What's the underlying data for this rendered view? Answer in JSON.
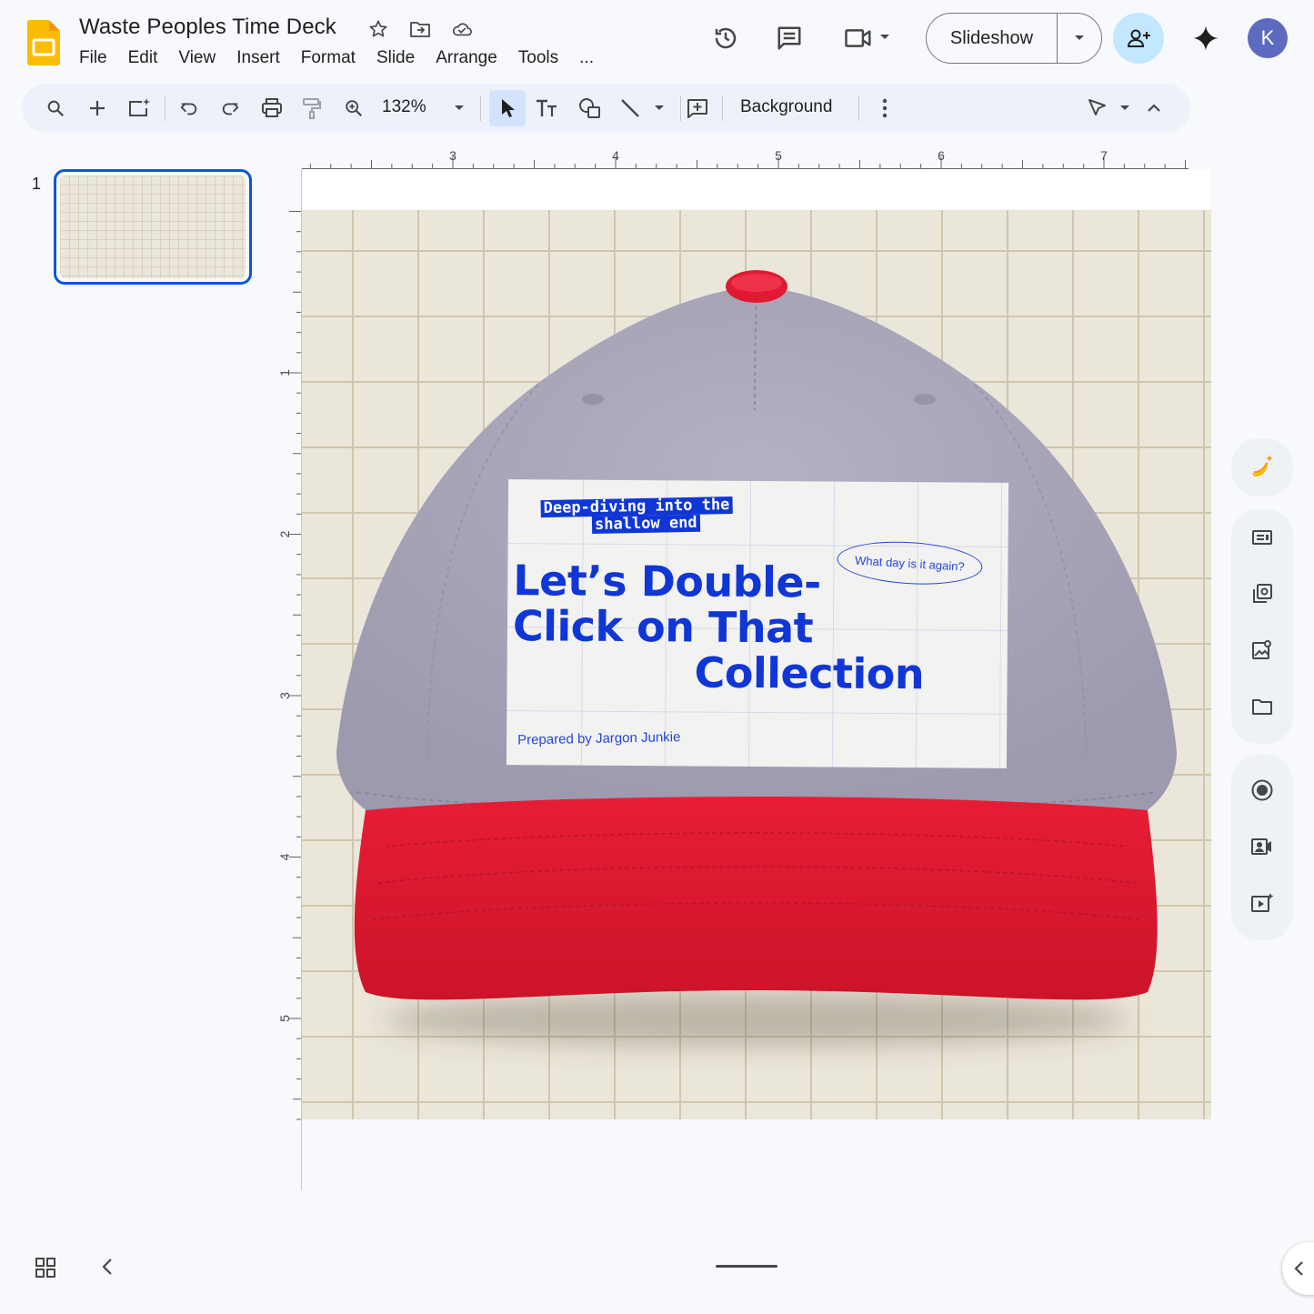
{
  "doc": {
    "title": "Waste Peoples Time Deck"
  },
  "menu": [
    "File",
    "Edit",
    "View",
    "Insert",
    "Format",
    "Slide",
    "Arrange",
    "Tools",
    "..."
  ],
  "header": {
    "slideshow_label": "Slideshow",
    "avatar_letter": "K"
  },
  "toolbar": {
    "zoom": "132%",
    "background_label": "Background"
  },
  "filmstrip": {
    "slides": [
      {
        "number": "1"
      }
    ]
  },
  "ruler": {
    "h_labels": [
      "3",
      "4",
      "5",
      "6",
      "7"
    ],
    "v_labels": [
      "1",
      "2",
      "3",
      "4",
      "5"
    ]
  },
  "slide": {
    "tag_line1": "Deep-diving into the",
    "tag_line2": "shallow end",
    "oval_text": "What day is it again?",
    "headline_line1": "Let’s Double-",
    "headline_line2": "Click on That",
    "headline_line3": "Collection",
    "byline": "Prepared by Jargon Junkie"
  },
  "colors": {
    "accent": "#0b57d0",
    "headline_blue": "#1036d6",
    "cap_crown": "#aca8bd",
    "cap_brim": "#dc1a32",
    "slide_bg": "#ebe6da"
  }
}
